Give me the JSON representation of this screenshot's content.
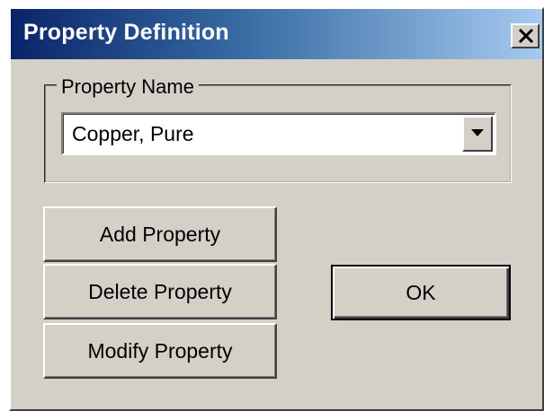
{
  "window": {
    "title": "Property Definition"
  },
  "icons": {
    "close": "close-icon",
    "dropdown": "chevron-down-icon"
  },
  "colors": {
    "titlebar_start": "#0a246a",
    "titlebar_end": "#a6caf0",
    "face": "#d4d0c8"
  },
  "property_group": {
    "legend": "Property Name",
    "selected_value": "Copper, Pure"
  },
  "buttons": {
    "add": "Add Property",
    "delete": "Delete Property",
    "modify": "Modify Property",
    "ok": "OK"
  }
}
